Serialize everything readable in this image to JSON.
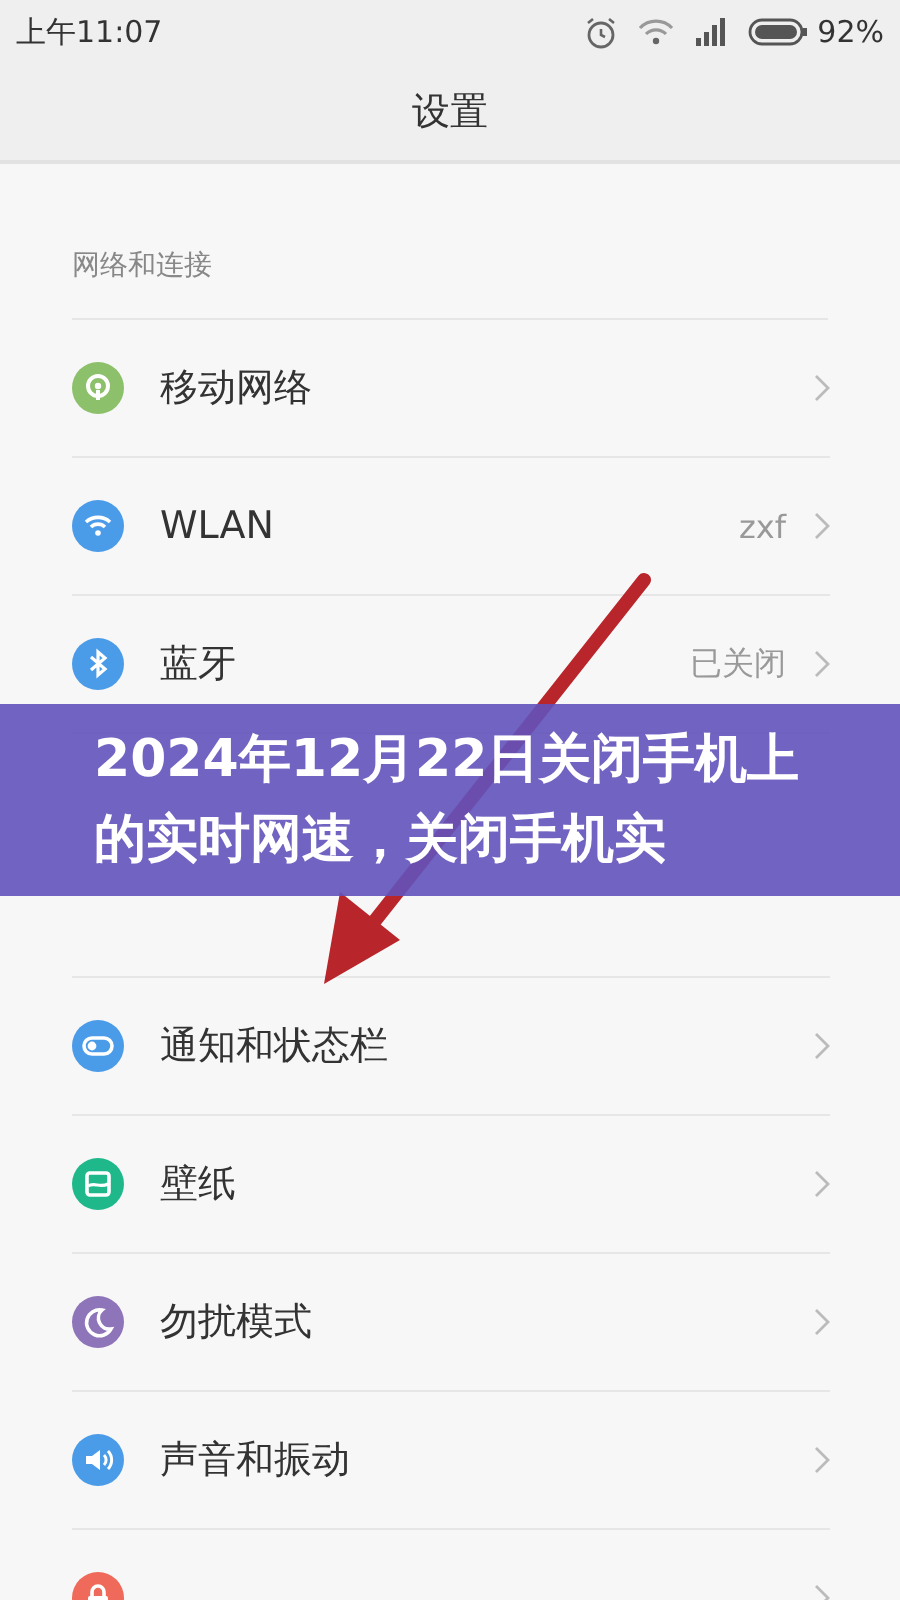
{
  "status_bar": {
    "time": "上午11:07",
    "battery": "92%"
  },
  "title_bar": {
    "title": "设置"
  },
  "sections": [
    {
      "header": "网络和连接",
      "items": [
        {
          "kind": "network",
          "label": "移动网络",
          "color": "#8cc06a"
        },
        {
          "kind": "wifi",
          "label": "WLAN",
          "value": "zxf",
          "color": "#4a9be8"
        },
        {
          "kind": "bluetooth",
          "label": "蓝牙",
          "value": "已关闭",
          "color": "#4a9be8"
        }
      ]
    },
    {
      "items": [
        {
          "kind": "toggle",
          "label": "通知和状态栏",
          "color": "#4a9be8"
        },
        {
          "kind": "wallpaper",
          "label": "壁纸",
          "color": "#1fb88a"
        },
        {
          "kind": "moon",
          "label": "勿扰模式",
          "color": "#8e74b8"
        },
        {
          "kind": "sound",
          "label": "声音和振动",
          "color": "#4a9be8"
        },
        {
          "kind": "lock",
          "color": "#ef6a5a"
        }
      ]
    }
  ],
  "banner": {
    "title": "2024年12月22日关闭手机上的实时网速，关闭手机实"
  }
}
